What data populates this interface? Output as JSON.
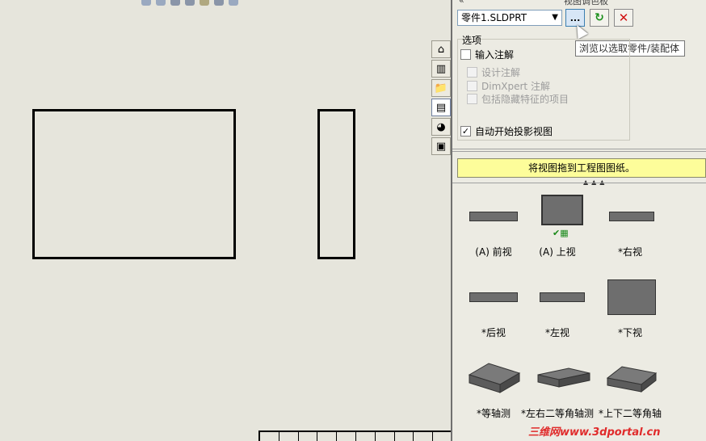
{
  "panel": {
    "title": "视图调色板",
    "part_file": "零件1.SLDPRT",
    "browse_label": "...",
    "tooltip": "浏览以选取零件/装配体",
    "options_title": "选项",
    "options": {
      "import_annotations": "输入注解",
      "design_annotations": "设计注解",
      "dimxpert_annotations": "DimXpert 注解",
      "include_hidden": "包括隐藏特征的项目",
      "auto_projected": "自动开始投影视图"
    },
    "hint": "将视图拖到工程图图纸。",
    "views": [
      {
        "label": "(A) 前视",
        "shape": "flat-wide"
      },
      {
        "label": "(A) 上视",
        "shape": "square-selected"
      },
      {
        "label": "*右视",
        "shape": "flat"
      },
      {
        "label": "*后视",
        "shape": "flat-wide"
      },
      {
        "label": "*左视",
        "shape": "flat"
      },
      {
        "label": "*下视",
        "shape": "square"
      },
      {
        "label": "*等轴测",
        "shape": "iso"
      },
      {
        "label": "*左右二等角轴测",
        "shape": "iso"
      },
      {
        "label": "*上下二等角轴",
        "shape": "iso"
      }
    ]
  },
  "sidebar_tabs": [
    "home-icon",
    "library-icon",
    "folder-icon",
    "view-palette-icon",
    "appearance-icon",
    "custom-properties-icon"
  ],
  "watermark": "三维网www.3dportal.cn",
  "colors": {
    "hint_bg": "#fdfd9a",
    "panel_bg": "#ecebe3",
    "sheet_bg": "#e6e5dc"
  }
}
